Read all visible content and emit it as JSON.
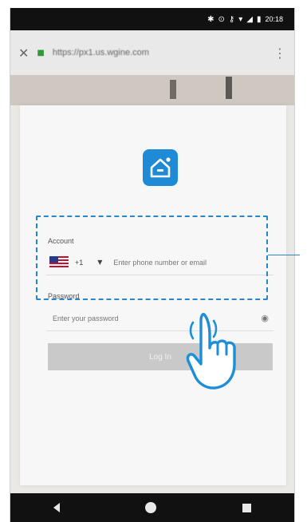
{
  "status_bar": {
    "time": "20:18"
  },
  "url_bar": {
    "url": "https://px1.us.wgine.com"
  },
  "login": {
    "account_label": "Account",
    "country_code": "+1",
    "account_placeholder": "Enter phone number or email",
    "password_label": "Password",
    "password_placeholder": "Enter your password",
    "login_button_label": "Log In"
  },
  "colors": {
    "accent": "#2a86c8",
    "logo_blue": "#1f8bd6",
    "login_button": "#c9c9c9"
  },
  "icons": [
    "close-icon",
    "lock-icon",
    "more-vert-icon",
    "home-logo-icon",
    "us-flag-icon",
    "chevron-down-icon",
    "eye-icon",
    "back-icon",
    "home-icon",
    "recent-apps-icon",
    "tap-hand-icon"
  ]
}
